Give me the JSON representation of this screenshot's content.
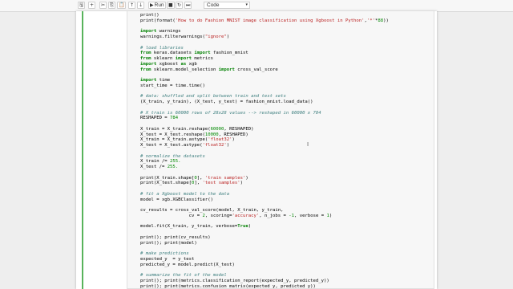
{
  "toolbar": {
    "buttons": [
      {
        "icon": "save-icon",
        "glyph": "🖫"
      },
      {
        "icon": "add-cell-icon",
        "glyph": "+"
      },
      {
        "icon": "cut-icon",
        "glyph": "✂"
      },
      {
        "icon": "copy-icon",
        "glyph": "⎘"
      },
      {
        "icon": "paste-icon",
        "glyph": "📋"
      },
      {
        "icon": "move-up-icon",
        "glyph": "↑"
      },
      {
        "icon": "move-down-icon",
        "glyph": "↓"
      }
    ],
    "run_label": "Run",
    "run_glyph": "▶",
    "stop_glyph": "■",
    "restart_glyph": "↻",
    "fast_forward_glyph": "⏭",
    "cell_type": "Code",
    "chevron_glyph": "▾"
  },
  "code_lines": [
    [
      {
        "t": "print()"
      }
    ],
    [
      {
        "t": "print(format("
      },
      {
        "t": "'How to do Fashion MNIST image classification using Xgboost in Python'",
        "c": "st"
      },
      {
        "t": ","
      },
      {
        "t": "'*'",
        "c": "st"
      },
      {
        "t": "*"
      },
      {
        "t": "88",
        "c": "nm"
      },
      {
        "t": "))"
      }
    ],
    [],
    [
      {
        "t": "import",
        "c": "kw"
      },
      {
        "t": " warnings"
      }
    ],
    [
      {
        "t": "warnings.filterwarnings("
      },
      {
        "t": "\"ignore\"",
        "c": "st"
      },
      {
        "t": ")"
      }
    ],
    [],
    [
      {
        "t": "# load libraries",
        "c": "cm"
      }
    ],
    [
      {
        "t": "from",
        "c": "kw"
      },
      {
        "t": " keras.datasets "
      },
      {
        "t": "import",
        "c": "kw"
      },
      {
        "t": " fashion_mnist"
      }
    ],
    [
      {
        "t": "from",
        "c": "kw"
      },
      {
        "t": " sklearn "
      },
      {
        "t": "import",
        "c": "kw"
      },
      {
        "t": " metrics"
      }
    ],
    [
      {
        "t": "import",
        "c": "kw"
      },
      {
        "t": " xgboost "
      },
      {
        "t": "as",
        "c": "kw"
      },
      {
        "t": " xgb"
      }
    ],
    [
      {
        "t": "from",
        "c": "kw"
      },
      {
        "t": " sklearn.model_selection "
      },
      {
        "t": "import",
        "c": "kw"
      },
      {
        "t": " cross_val_score"
      }
    ],
    [],
    [
      {
        "t": "import",
        "c": "kw"
      },
      {
        "t": " time"
      }
    ],
    [
      {
        "t": "start_time = time.time()"
      }
    ],
    [],
    [
      {
        "t": "# data: shuffled and split between train and test sets",
        "c": "cm"
      }
    ],
    [
      {
        "t": "(X_train, y_train), (X_test, y_test) = fashion_mnist.load_data()"
      }
    ],
    [],
    [
      {
        "t": "# X_train is 60000 rows of 28x28 values --> reshaped in 60000 x 784",
        "c": "cm"
      }
    ],
    [
      {
        "t": "RESHAPED = "
      },
      {
        "t": "784",
        "c": "nm"
      }
    ],
    [],
    [
      {
        "t": "X_train = X_train.reshape("
      },
      {
        "t": "60000",
        "c": "nm"
      },
      {
        "t": ", RESHAPED)"
      }
    ],
    [
      {
        "t": "X_test = X_test.reshape("
      },
      {
        "t": "10000",
        "c": "nm"
      },
      {
        "t": ", RESHAPED)"
      }
    ],
    [
      {
        "t": "X_train = X_train.astype("
      },
      {
        "t": "'float32'",
        "c": "st"
      },
      {
        "t": ")"
      }
    ],
    [
      {
        "t": "X_test = X_test.astype("
      },
      {
        "t": "'float32'",
        "c": "st"
      },
      {
        "t": ")"
      }
    ],
    [],
    [
      {
        "t": "# normalize the datasets",
        "c": "cm"
      }
    ],
    [
      {
        "t": "X_train /= "
      },
      {
        "t": "255.",
        "c": "nm"
      }
    ],
    [
      {
        "t": "X_test /= "
      },
      {
        "t": "255.",
        "c": "nm"
      }
    ],
    [],
    [
      {
        "t": "print(X_train.shape["
      },
      {
        "t": "0",
        "c": "nm"
      },
      {
        "t": "], "
      },
      {
        "t": "'train samples'",
        "c": "st"
      },
      {
        "t": ")"
      }
    ],
    [
      {
        "t": "print(X_test.shape["
      },
      {
        "t": "0",
        "c": "nm"
      },
      {
        "t": "], "
      },
      {
        "t": "'test samples'",
        "c": "st"
      },
      {
        "t": ")"
      }
    ],
    [],
    [
      {
        "t": "# fit a Xgboost model to the data",
        "c": "cm"
      }
    ],
    [
      {
        "t": "model = xgb.XGBClassifier()"
      }
    ],
    [],
    [
      {
        "t": "cv_results = cross_val_score(model, X_train, y_train,"
      }
    ],
    [
      {
        "t": "                  cv = "
      },
      {
        "t": "2",
        "c": "nm"
      },
      {
        "t": ", scoring="
      },
      {
        "t": "'accuracy'",
        "c": "st"
      },
      {
        "t": ", n_jobs = "
      },
      {
        "t": "-1",
        "c": "nm"
      },
      {
        "t": ", verbose = "
      },
      {
        "t": "1",
        "c": "nm"
      },
      {
        "t": ")"
      }
    ],
    [],
    [
      {
        "t": "model.fit(X_train, y_train, verbose="
      },
      {
        "t": "True",
        "c": "kw"
      },
      {
        "t": ")"
      }
    ],
    [],
    [
      {
        "t": "print(); print(cv_results)"
      }
    ],
    [
      {
        "t": "print(); print(model)"
      }
    ],
    [],
    [
      {
        "t": "# make predictions",
        "c": "cm"
      }
    ],
    [
      {
        "t": "expected_y  = y_test"
      }
    ],
    [
      {
        "t": "predicted_y = model.predict(X_test)"
      }
    ],
    [],
    [
      {
        "t": "# summarize the fit of the model",
        "c": "cm"
      }
    ],
    [
      {
        "t": "print(); print(metrics.classification_report(expected_y, predicted_y))"
      }
    ],
    [
      {
        "t": "print(); print(metrics.confusion_matrix(expected_y, predicted_y))"
      }
    ]
  ],
  "cursor_glyph": "I"
}
